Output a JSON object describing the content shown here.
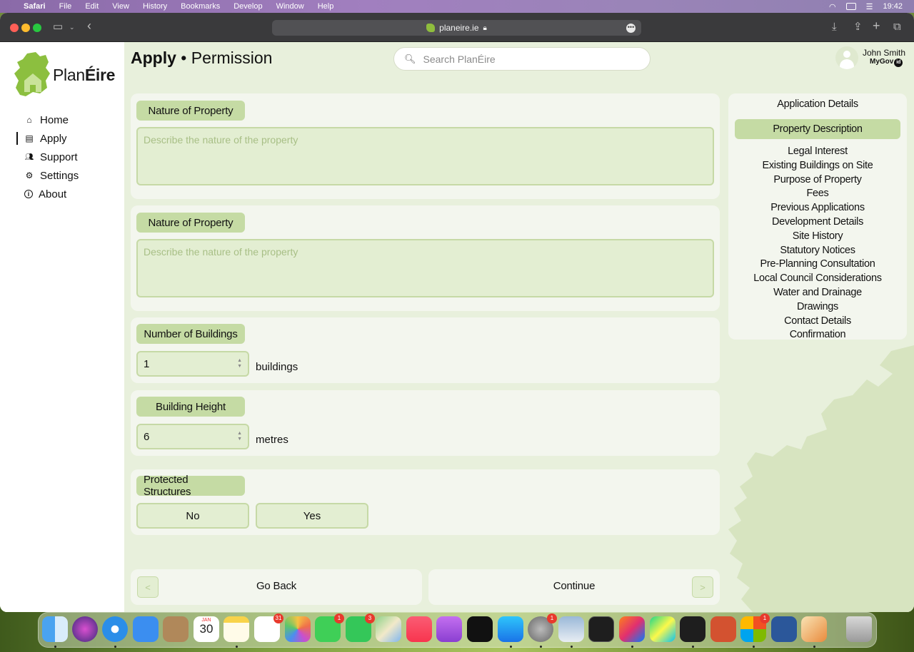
{
  "menubar": {
    "items": [
      "Safari",
      "File",
      "Edit",
      "View",
      "History",
      "Bookmarks",
      "Develop",
      "Window",
      "Help"
    ],
    "clock": "19:42"
  },
  "browser": {
    "url": "planeire.ie"
  },
  "brand": {
    "name_plain": "Plan",
    "name_bold": "Éire",
    "accent_color": "#c5dba4",
    "page_bg": "#e8f0dc"
  },
  "sidebar": {
    "items": [
      {
        "label": "Home",
        "icon": "home-icon"
      },
      {
        "label": "Apply",
        "icon": "document-icon"
      },
      {
        "label": "Support",
        "icon": "people-icon"
      },
      {
        "label": "Settings",
        "icon": "gear-icon"
      },
      {
        "label": "About",
        "icon": "info-icon"
      }
    ],
    "active": "Apply"
  },
  "header": {
    "title_bold": "Apply",
    "title_rest": " • Permission",
    "search_placeholder": "Search PlanÉire"
  },
  "user": {
    "name": "John Smith",
    "id_provider": "MyGov",
    "id_badge": "id"
  },
  "form": {
    "nature1": {
      "label": "Nature of Property",
      "placeholder": "Describe the nature of the property"
    },
    "nature2": {
      "label": "Nature of Property",
      "placeholder": "Describe the nature of the property"
    },
    "buildings": {
      "label": "Number of Buildings",
      "value": "1",
      "unit": "buildings"
    },
    "height": {
      "label": "Building Height",
      "value": "6",
      "unit": "metres"
    },
    "protected": {
      "label": "Protected Structures",
      "options": [
        "No",
        "Yes"
      ]
    }
  },
  "steps": {
    "items": [
      "Application Details",
      "Property Description",
      "Legal Interest",
      "Existing Buildings on Site",
      "Purpose of Property",
      "Fees",
      "Previous Applications",
      "Development Details",
      "Site History",
      "Statutory Notices",
      "Pre-Planning Consultation",
      "Local Council Considerations",
      "Water and Drainage",
      "Drawings",
      "Contact Details",
      "Confirmation"
    ],
    "active": "Property Description"
  },
  "footer": {
    "back_label": "Go Back",
    "back_icon": "<",
    "continue_label": "Continue",
    "continue_icon": ">"
  },
  "dock": {
    "calendar_month": "JAN",
    "calendar_day": "30",
    "badges": {
      "reminders": "31",
      "messages": "1",
      "facetime": "3",
      "settings": "1",
      "store": "1"
    }
  }
}
